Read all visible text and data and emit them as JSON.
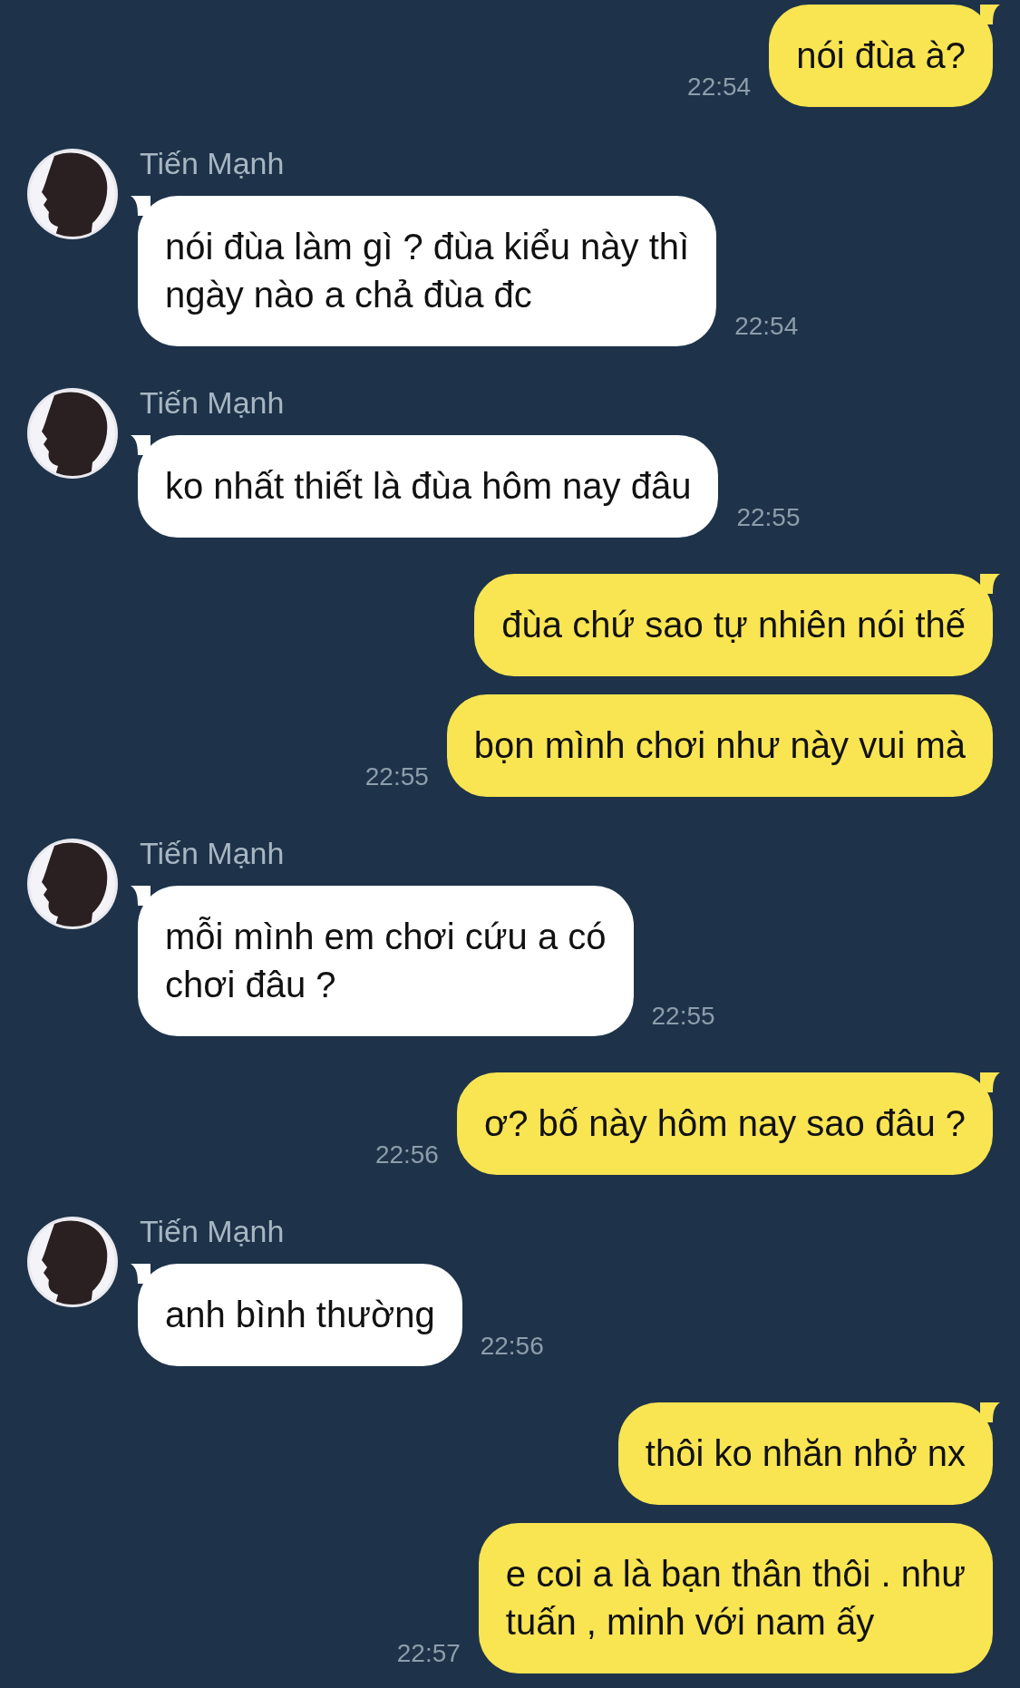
{
  "messages": [
    {
      "kind": "sent",
      "bubbles": [
        "nói đùa à?"
      ],
      "time": "22:54"
    },
    {
      "kind": "received",
      "sender": "Tiến Mạnh",
      "bubbles": [
        "nói đùa làm gì ? đùa kiểu này thì\nngày nào a chả đùa đc"
      ],
      "time": "22:54"
    },
    {
      "kind": "received",
      "sender": "Tiến Mạnh",
      "bubbles": [
        "ko nhất thiết là đùa hôm nay đâu"
      ],
      "time": "22:55"
    },
    {
      "kind": "sent",
      "bubbles": [
        "đùa chứ sao tự nhiên nói thế",
        "bọn mình chơi như này vui mà"
      ],
      "time": "22:55"
    },
    {
      "kind": "received",
      "sender": "Tiến Mạnh",
      "bubbles": [
        "mỗi mình em chơi cứu a có\nchơi đâu ?"
      ],
      "time": "22:55"
    },
    {
      "kind": "sent",
      "bubbles": [
        "ơ? bố này hôm nay sao đâu ?"
      ],
      "time": "22:56"
    },
    {
      "kind": "received",
      "sender": "Tiến Mạnh",
      "bubbles": [
        "anh bình thường"
      ],
      "time": "22:56"
    },
    {
      "kind": "sent",
      "bubbles": [
        "thôi ko nhăn nhở nx",
        "e coi a là bạn thân thôi . như\ntuấn , minh với nam ấy"
      ],
      "time": "22:57"
    }
  ]
}
